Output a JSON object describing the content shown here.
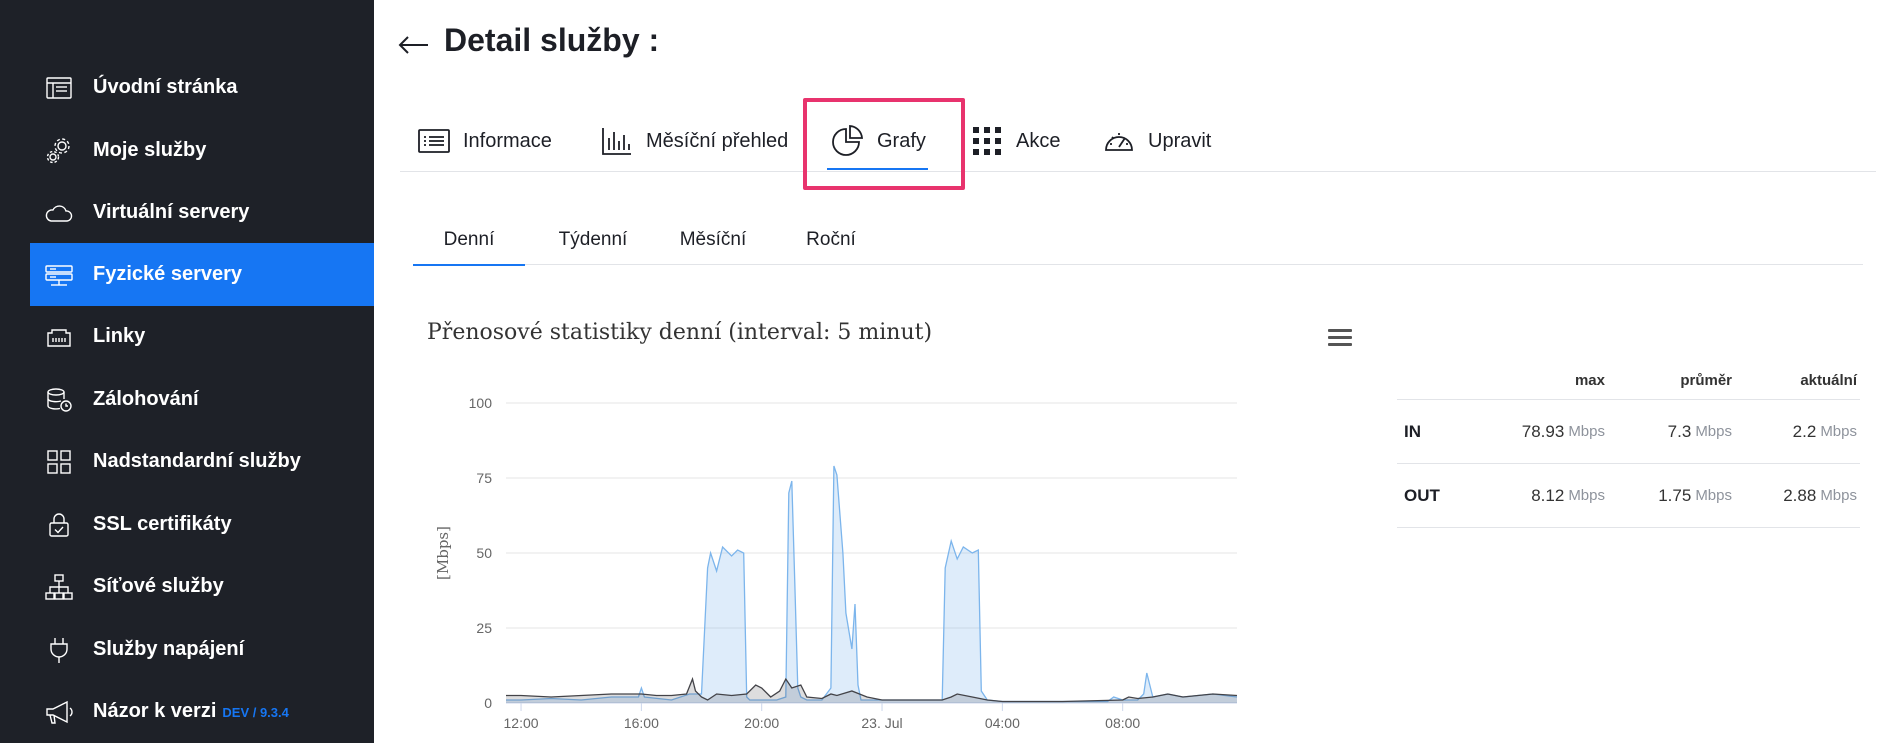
{
  "sidebar": {
    "items": [
      {
        "label": "Úvodní stránka",
        "icon": "browser-window-icon"
      },
      {
        "label": "Moje služby",
        "icon": "gears-icon"
      },
      {
        "label": "Virtuální servery",
        "icon": "cloud-icon"
      },
      {
        "label": "Fyzické servery",
        "icon": "server-rack-icon",
        "active": true
      },
      {
        "label": "Linky",
        "icon": "ethernet-port-icon"
      },
      {
        "label": "Zálohování",
        "icon": "database-clock-icon"
      },
      {
        "label": "Nadstandardní služby",
        "icon": "grid-squares-icon"
      },
      {
        "label": "SSL certifikáty",
        "icon": "lock-check-icon"
      },
      {
        "label": "Síťové služby",
        "icon": "network-hierarchy-icon"
      },
      {
        "label": "Služby napájení",
        "icon": "power-plug-icon"
      },
      {
        "label": "Názor k verzi",
        "icon": "megaphone-icon",
        "version": "DEV / 9.3.4"
      }
    ]
  },
  "header": {
    "title": "Detail služby :"
  },
  "tabs": [
    {
      "label": "Informace",
      "icon": "list-icon"
    },
    {
      "label": "Měsíční přehled",
      "icon": "bar-chart-icon"
    },
    {
      "label": "Grafy",
      "icon": "pie-chart-icon",
      "active": true
    },
    {
      "label": "Akce",
      "icon": "dots-grid-icon"
    },
    {
      "label": "Upravit",
      "icon": "speedometer-icon"
    }
  ],
  "subtabs": [
    {
      "label": "Denní",
      "active": true
    },
    {
      "label": "Týdenní"
    },
    {
      "label": "Měsíční"
    },
    {
      "label": "Roční"
    }
  ],
  "stats": {
    "headers": [
      "max",
      "průměr",
      "aktuální"
    ],
    "rows": [
      {
        "label": "IN",
        "values": [
          "78.93",
          "7.3",
          "2.2"
        ],
        "unit": "Mbps"
      },
      {
        "label": "OUT",
        "values": [
          "8.12",
          "1.75",
          "2.88"
        ],
        "unit": "Mbps"
      }
    ]
  },
  "colors": {
    "sidebar_bg": "#1e2128",
    "accent": "#1676f3",
    "highlight": "#e8336d",
    "series_in": "#7cb5ec",
    "series_out": "#434348"
  },
  "chart_data": {
    "type": "area",
    "title": "Přenosové statistiky denní (interval: 5 minut)",
    "ylabel": "[Mbps]",
    "ylim": [
      0,
      100
    ],
    "yticks": [
      0,
      25,
      50,
      75,
      100
    ],
    "xlim": [
      11.5,
      35.8
    ],
    "xticks": [
      {
        "h": 12,
        "label": "12:00"
      },
      {
        "h": 16,
        "label": "16:00"
      },
      {
        "h": 20,
        "label": "20:00"
      },
      {
        "h": 24,
        "label": "23. Jul"
      },
      {
        "h": 28,
        "label": "04:00"
      },
      {
        "h": 32,
        "label": "08:00"
      }
    ],
    "grid": true,
    "series": [
      {
        "name": "IN",
        "x": [
          11.5,
          12,
          13,
          14,
          15,
          15.9,
          16,
          16.1,
          17,
          17.6,
          18,
          18.2,
          18.3,
          18.5,
          18.7,
          19,
          19.2,
          19.4,
          19.5,
          19.6,
          20,
          20.5,
          20.8,
          20.9,
          21,
          21.1,
          21.2,
          21.3,
          21.5,
          22,
          22.3,
          22.4,
          22.5,
          22.7,
          22.8,
          23,
          23.1,
          23.2,
          23.3,
          23.5,
          24,
          25,
          26,
          26.1,
          26.3,
          26.5,
          26.7,
          27,
          27.2,
          27.3,
          27.5,
          28,
          30,
          31.5,
          31.7,
          32,
          32.5,
          32.7,
          32.8,
          33,
          33.5,
          34,
          35,
          35.8
        ],
        "y": [
          1,
          1,
          1.5,
          1,
          2,
          2,
          5,
          2,
          1,
          3,
          3,
          45,
          50,
          44,
          52,
          49,
          51,
          50,
          2,
          1,
          1,
          1,
          2,
          70,
          74,
          40,
          5,
          2,
          1,
          1,
          5,
          79,
          76,
          50,
          30,
          18,
          33,
          6,
          1,
          1,
          1,
          1,
          1,
          45,
          54,
          48,
          52,
          50,
          51,
          4,
          1,
          0.5,
          0.5,
          0.5,
          2,
          1,
          1,
          3,
          10,
          2,
          3,
          2,
          3,
          2
        ]
      },
      {
        "name": "OUT",
        "x": [
          11.5,
          12,
          13,
          14,
          15,
          16,
          16.5,
          17,
          17.5,
          17.7,
          17.8,
          18,
          18.2,
          18.5,
          19,
          19.5,
          19.8,
          20,
          20.3,
          20.6,
          20.8,
          21,
          21.3,
          21.5,
          22,
          22.3,
          22.5,
          23,
          23.5,
          24,
          25,
          26,
          26.3,
          26.5,
          27,
          27.5,
          28,
          30,
          32,
          32.2,
          32.5,
          33,
          33.5,
          34,
          35,
          35.8
        ],
        "y": [
          2.5,
          2.5,
          2,
          2.5,
          3,
          3,
          2.5,
          2.5,
          3,
          8,
          4,
          2,
          1,
          3,
          2.5,
          3,
          6,
          5,
          2,
          4,
          8,
          5,
          6,
          2,
          1.5,
          3,
          2.5,
          4,
          2,
          1,
          1,
          1,
          2,
          3,
          2,
          1,
          0.5,
          0.5,
          1,
          2,
          1.5,
          2,
          3,
          2,
          3,
          2.5
        ]
      }
    ]
  }
}
